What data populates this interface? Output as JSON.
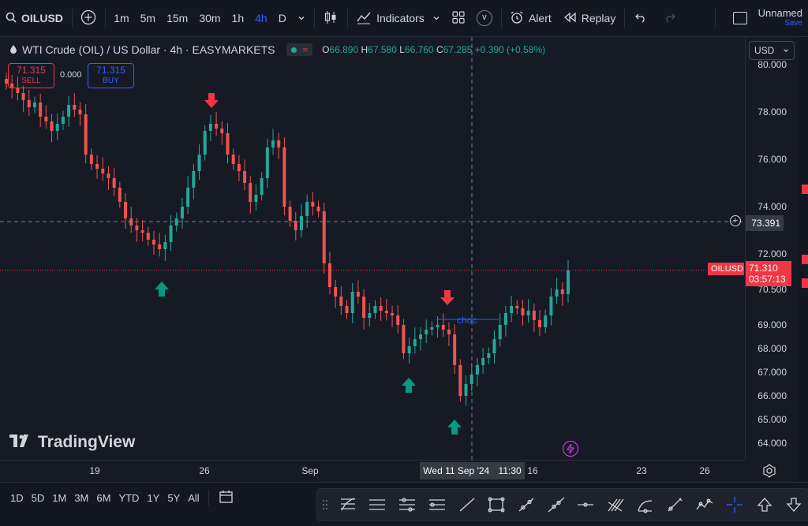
{
  "toolbar": {
    "symbol": "OILUSD",
    "timeframes": [
      "1m",
      "5m",
      "15m",
      "30m",
      "1h",
      "4h",
      "D"
    ],
    "active_timeframe": "4h",
    "indicators_label": "Indicators",
    "alert_label": "Alert",
    "replay_label": "Replay",
    "layout_name": "Unnamed",
    "save_label": "Save",
    "v_label": "v"
  },
  "legend": {
    "title": "WTI Crude (OIL) / US Dollar · 4h · EASYMARKETS",
    "o_key": "O",
    "o_val": "66.890",
    "h_key": "H",
    "h_val": "67.580",
    "l_key": "L",
    "l_val": "66.760",
    "c_key": "C",
    "c_val": "67.285",
    "change": "+0.390 (+0.58%)"
  },
  "trade": {
    "sell_price": "71.315",
    "sell_label": "SELL",
    "buy_price": "71.315",
    "buy_label": "BUY",
    "spread": "0.000"
  },
  "price_scale": {
    "currency": "USD",
    "labels": [
      "80.000",
      "78.000",
      "76.000",
      "74.000",
      "72.000",
      "70.500",
      "69.000",
      "68.000",
      "67.000",
      "66.000",
      "65.000",
      "64.000"
    ],
    "crosshair_price": "73.391",
    "last_price_symbol": "OILUSD",
    "last_price": "71.310",
    "countdown": "03:57:13"
  },
  "time_scale": {
    "labels": [
      "19",
      "26",
      "Sep",
      "16",
      "23",
      "26"
    ],
    "crosshair_time": "Wed 11 Sep '24",
    "crosshair_clock": "11:30"
  },
  "annotations": {
    "choch_label": "choc"
  },
  "branding": {
    "logo_text": "TradingView"
  },
  "bottom": {
    "ranges": [
      "1D",
      "5D",
      "1M",
      "3M",
      "6M",
      "YTD",
      "1Y",
      "5Y",
      "All"
    ]
  },
  "colors": {
    "up": "#26a69a",
    "down": "#ef5350",
    "accent": "#2962ff",
    "bg": "#161a25"
  },
  "chart_data": {
    "type": "candlestick",
    "title": "WTI Crude (OIL) / US Dollar · 4h · EASYMARKETS",
    "ylim": [
      63.5,
      80.5
    ],
    "x_ticks": [
      "19",
      "26",
      "Sep",
      "16",
      "23",
      "26"
    ],
    "closes": [
      79.2,
      79.0,
      78.8,
      78.5,
      78.2,
      78.4,
      77.8,
      77.6,
      77.2,
      77.5,
      77.8,
      78.3,
      78.1,
      77.9,
      76.2,
      75.8,
      75.6,
      75.4,
      75.2,
      74.8,
      74.2,
      73.5,
      73.2,
      73.0,
      72.9,
      72.6,
      72.4,
      72.2,
      72.5,
      73.2,
      73.5,
      74.0,
      74.8,
      75.5,
      76.2,
      77.2,
      77.5,
      77.3,
      77.1,
      76.2,
      75.8,
      75.5,
      75.0,
      74.2,
      74.5,
      75.2,
      76.5,
      76.8,
      76.5,
      74.0,
      73.4,
      73.0,
      73.6,
      74.2,
      74.0,
      73.8,
      71.6,
      70.6,
      70.2,
      69.8,
      69.5,
      70.4,
      70.2,
      69.3,
      69.5,
      69.8,
      69.6,
      69.5,
      69.4,
      69.0,
      67.8,
      68.1,
      68.4,
      68.6,
      68.8,
      68.9,
      69.0,
      68.8,
      68.6,
      67.3,
      66.0,
      66.5,
      66.9,
      67.3,
      67.6,
      67.8,
      68.4,
      69.0,
      69.5,
      69.8,
      69.7,
      69.4,
      69.6,
      69.2,
      68.9,
      69.4,
      70.2,
      70.5,
      70.3,
      71.3
    ]
  }
}
